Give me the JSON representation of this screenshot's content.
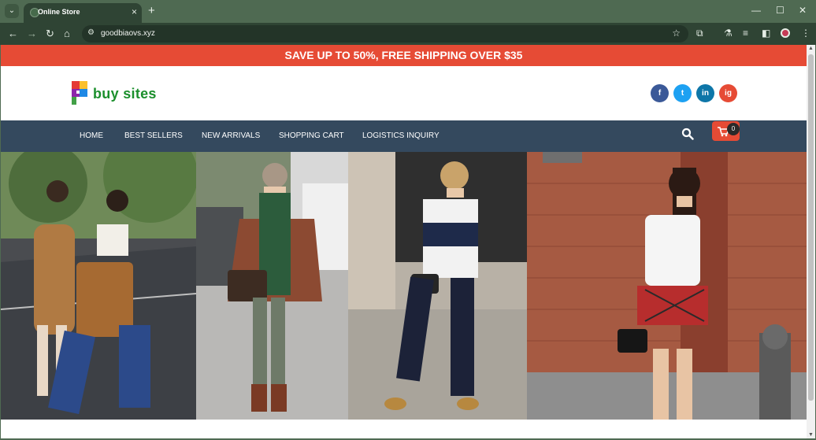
{
  "browser": {
    "tab_title": "Online Store",
    "url": "goodbiaovs.xyz",
    "new_tab_label": "+",
    "tab_close_label": "×"
  },
  "site": {
    "promo_text": "SAVE UP TO 50%, FREE SHIPPING OVER $35",
    "logo_text": "buy sites",
    "social": [
      {
        "name": "facebook",
        "label": "f",
        "color": "#3b5998"
      },
      {
        "name": "twitter",
        "label": "t",
        "color": "#1da1f2"
      },
      {
        "name": "linkedin",
        "label": "in",
        "color": "#0e76a8"
      },
      {
        "name": "instagram",
        "label": "ig",
        "color": "#e64b35"
      }
    ],
    "nav": [
      "HOME",
      "BEST SELLERS",
      "NEW ARRIVALS",
      "SHOPPING CART",
      "LOGISTICS INQUIRY"
    ],
    "cart_count": "0"
  },
  "colors": {
    "browser_frame": "#4f6a52",
    "promo_bg": "#e64b35",
    "navbar_bg": "#34495e",
    "logo_green": "#1b8f2c"
  },
  "icons": [
    "search-icon",
    "cart-icon",
    "facebook-icon",
    "twitter-icon",
    "linkedin-icon",
    "instagram-icon",
    "back-icon",
    "forward-icon",
    "reload-icon",
    "home-icon",
    "star-icon",
    "extensions-icon",
    "menu-icon"
  ]
}
